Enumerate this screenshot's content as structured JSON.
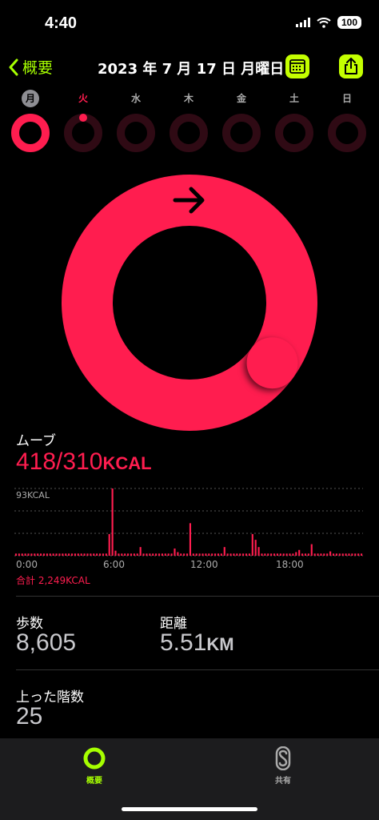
{
  "status_bar": {
    "time": "4:40",
    "battery": "100"
  },
  "header": {
    "back_label": "概要",
    "title": "2023 年 7 月 17 日 月曜日"
  },
  "week": [
    {
      "label": "月",
      "progress": 1.35
    },
    {
      "label": "火",
      "progress": 0.03
    },
    {
      "label": "水",
      "progress": 0
    },
    {
      "label": "木",
      "progress": 0
    },
    {
      "label": "金",
      "progress": 0
    },
    {
      "label": "土",
      "progress": 0
    },
    {
      "label": "日",
      "progress": 0
    }
  ],
  "move": {
    "label": "ムーブ",
    "value": "418/310",
    "unit": "KCAL",
    "progress": 1.35,
    "chart_ylabel": "93KCAL",
    "x_ticks": [
      "0:00",
      "6:00",
      "12:00",
      "18:00"
    ],
    "total": "合計 2,249KCAL"
  },
  "chart_data": {
    "type": "bar",
    "title": "",
    "xlabel": "",
    "ylabel": "93KCAL",
    "ylim": [
      0,
      93
    ],
    "x_ticks": [
      "0:00",
      "6:00",
      "12:00",
      "18:00"
    ],
    "bins_per_hour": 4,
    "values": [
      3,
      3,
      3,
      3,
      3,
      3,
      3,
      3,
      3,
      3,
      3,
      3,
      3,
      3,
      3,
      3,
      3,
      3,
      3,
      3,
      3,
      3,
      3,
      3,
      3,
      3,
      3,
      3,
      3,
      3,
      30,
      93,
      7,
      3,
      3,
      3,
      3,
      3,
      3,
      3,
      12,
      3,
      3,
      3,
      3,
      3,
      3,
      3,
      3,
      3,
      3,
      10,
      5,
      3,
      3,
      3,
      45,
      3,
      3,
      3,
      3,
      3,
      3,
      3,
      3,
      3,
      3,
      12,
      3,
      3,
      3,
      3,
      3,
      3,
      3,
      3,
      30,
      22,
      12,
      3,
      3,
      3,
      3,
      3,
      3,
      3,
      3,
      3,
      3,
      3,
      5,
      8,
      3,
      3,
      3,
      16,
      3,
      3,
      3,
      3,
      3,
      6,
      3,
      3,
      3,
      3,
      3,
      3,
      3,
      3,
      3,
      3
    ]
  },
  "stats": {
    "steps_label": "歩数",
    "steps_value": "8,605",
    "distance_label": "距離",
    "distance_value": "5.51",
    "distance_unit": "KM",
    "floors_label": "上った階数",
    "floors_value": "25"
  },
  "tabs": [
    {
      "label": "概要",
      "icon": "activity-ring-icon",
      "active": true
    },
    {
      "label": "共有",
      "icon": "sharing-icon",
      "active": false
    }
  ],
  "colors": {
    "move": "#ff1d4f",
    "accent": "#a6ff00",
    "ring_track": "#2f0a14"
  }
}
